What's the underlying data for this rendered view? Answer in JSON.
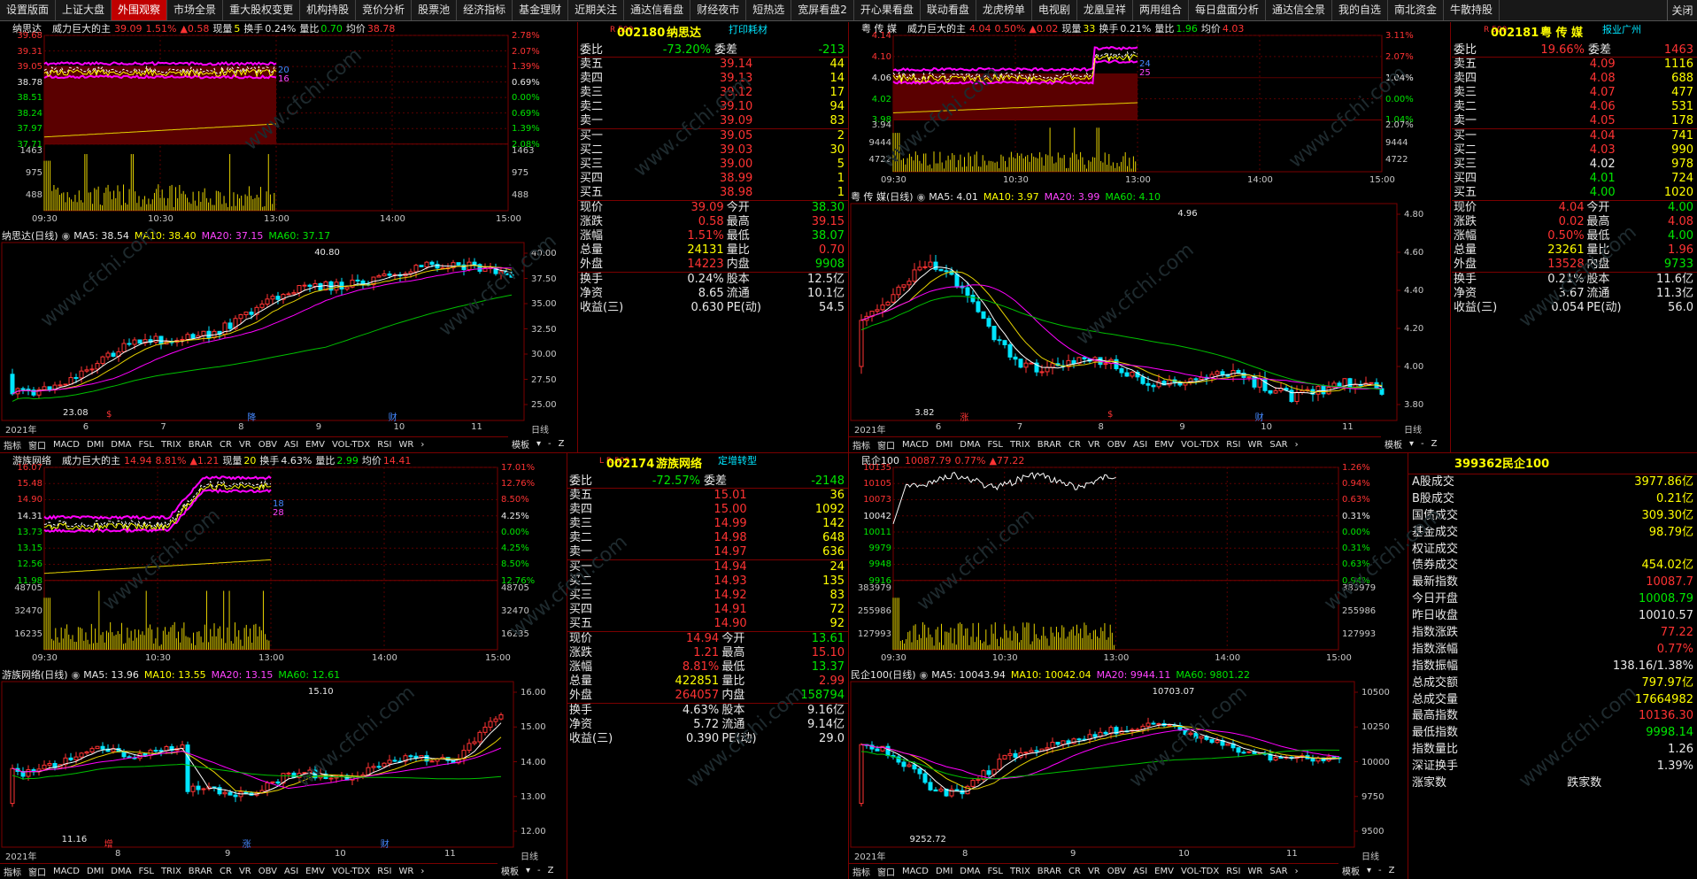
{
  "tabs": [
    "设置版面",
    "上证大盘",
    "外围观察",
    "市场全景",
    "重大股权变更",
    "机构持股",
    "竞价分析",
    "股票池",
    "经济指标",
    "基金理财",
    "近期关注",
    "通达信看盘",
    "财经夜市",
    "短热选",
    "宽屏看盘2",
    "开心果看盘",
    "联动看盘",
    "龙虎榜单",
    "电视剧",
    "龙凰呈祥",
    "两用组合",
    "每日盘面分析",
    "通达信全景",
    "我的自选",
    "南北资金",
    "牛散持股"
  ],
  "active_tab": 2,
  "close_label": "关闭",
  "watermark": "www.cfchi.com",
  "bottom_tabs": [
    "指标",
    "窗口",
    "MACD",
    "DMI",
    "DMA",
    "FSL",
    "TRIX",
    "BRAR",
    "CR",
    "VR",
    "OBV",
    "ASI",
    "EMV",
    "VOL-TDX",
    "RSI",
    "WR",
    "›"
  ],
  "bottom_tabs_b": [
    "指标",
    "窗口",
    "MACD",
    "DMI",
    "DMA",
    "FSL",
    "TRIX",
    "BRAR",
    "CR",
    "VR",
    "OBV",
    "ASI",
    "EMV",
    "VOL-TDX",
    "RSI",
    "WR",
    "SAR",
    "›"
  ],
  "bottom_right": [
    "模板",
    "▾",
    "-",
    "Z"
  ],
  "stocks": [
    {
      "id": "s1",
      "name": "纳思达",
      "indic": "威力巨大的主",
      "price": "39.09",
      "pct": "1.51%",
      "chg": "▲0.58",
      "vol_label": "现量",
      "vol": "5",
      "turn_label": "换手",
      "turn": "0.24%",
      "ratio_label": "量比",
      "ratio": "0.70",
      "avg_label": "均价",
      "avg": "38.78",
      "yl": [
        "39.68",
        "39.31",
        "39.05",
        "38.78",
        "38.51",
        "38.24",
        "37.97",
        "37.71",
        "1463",
        "975",
        "488"
      ],
      "yr": [
        "2.78%",
        "2.07%",
        "1.39%",
        "0.69%",
        "0.00%",
        "0.69%",
        "1.39%",
        "2.08%",
        "1463",
        "975",
        "488"
      ],
      "times": [
        "09:30",
        "10:30",
        "13:00",
        "14:00",
        "15:00"
      ],
      "marks": [
        "20",
        "16"
      ],
      "daily_title": "纳思达(日线)",
      "ma5": "MA5: 38.54",
      "ma10": "MA10: 38.40",
      "ma20": "MA20: 37.15",
      "ma60": "MA60: 37.17",
      "daily_y": [
        "40.00",
        "37.50",
        "35.00",
        "32.50",
        "30.00",
        "27.50",
        "25.00"
      ],
      "daily_hi": "40.80",
      "daily_lo": "23.08",
      "months": [
        "2021年",
        "6",
        "7",
        "8",
        "9",
        "10",
        "11"
      ],
      "events": [
        "$",
        "降",
        "财"
      ],
      "period": "日线",
      "code": "002180",
      "code_name": "纳思达",
      "code_tag": "打印耗材",
      "prefix": "R 500",
      "wb": "-73.20%",
      "wc": "-213",
      "sells": [
        [
          "卖五",
          "39.14",
          "44"
        ],
        [
          "卖四",
          "39.13",
          "14"
        ],
        [
          "卖三",
          "39.12",
          "17"
        ],
        [
          "卖二",
          "39.10",
          "94"
        ],
        [
          "卖一",
          "39.09",
          "83"
        ]
      ],
      "buys": [
        [
          "买一",
          "39.05",
          "2"
        ],
        [
          "买二",
          "39.03",
          "30"
        ],
        [
          "买三",
          "39.00",
          "5"
        ],
        [
          "买四",
          "38.99",
          "1"
        ],
        [
          "买五",
          "38.98",
          "1"
        ]
      ],
      "q": [
        [
          "现价",
          "39.09",
          "今开",
          "38.30"
        ],
        [
          "涨跌",
          "0.58",
          "最高",
          "39.15"
        ],
        [
          "涨幅",
          "1.51%",
          "最低",
          "38.07"
        ],
        [
          "总量",
          "24131",
          "量比",
          "0.70"
        ],
        [
          "外盘",
          "14223",
          "内盘",
          "9908"
        ]
      ],
      "f": [
        [
          "换手",
          "0.24%",
          "股本",
          "12.5亿"
        ],
        [
          "净资",
          "8.65",
          "流通",
          "10.1亿"
        ],
        [
          "收益(三)",
          "0.630",
          "PE(动)",
          "54.5"
        ]
      ]
    },
    {
      "id": "s2",
      "name": "粤 传 媒",
      "indic": "威力巨大的主",
      "price": "4.04",
      "pct": "0.50%",
      "chg": "▲0.02",
      "vol_label": "现量",
      "vol": "33",
      "turn_label": "换手",
      "turn": "0.21%",
      "ratio_label": "量比",
      "ratio": "1.96",
      "avg_label": "均价",
      "avg": "4.03",
      "yl": [
        "4.14",
        "4.10",
        "4.06",
        "4.02",
        "3.98",
        "3.94",
        "9444",
        "4722"
      ],
      "yr": [
        "3.11%",
        "2.07%",
        "1.04%",
        "0.00%",
        "1.04%",
        "2.07%",
        "9444",
        "4722"
      ],
      "times": [
        "09:30",
        "10:30",
        "13:00",
        "14:00",
        "15:00"
      ],
      "marks": [
        "24",
        "25"
      ],
      "daily_title": "粤 传 媒(日线)",
      "ma5": "MA5: 4.01",
      "ma10": "MA10: 3.97",
      "ma20": "MA20: 3.99",
      "ma60": "MA60: 4.10",
      "daily_y": [
        "4.80",
        "4.60",
        "4.40",
        "4.20",
        "4.00",
        "3.80"
      ],
      "daily_hi": "4.96",
      "daily_lo": "3.82",
      "months": [
        "2021年",
        "6",
        "7",
        "8",
        "9",
        "10",
        "11"
      ],
      "events": [
        "涨",
        "$",
        "财"
      ],
      "period": "日线",
      "code": "002181",
      "code_name": "粤 传 媒",
      "code_tag": "报业广州",
      "prefix": "R 500",
      "wb": "19.66%",
      "wc": "1463",
      "sells": [
        [
          "卖五",
          "4.09",
          "1116"
        ],
        [
          "卖四",
          "4.08",
          "688"
        ],
        [
          "卖三",
          "4.07",
          "477"
        ],
        [
          "卖二",
          "4.06",
          "531"
        ],
        [
          "卖一",
          "4.05",
          "178"
        ]
      ],
      "buys": [
        [
          "买一",
          "4.04",
          "741"
        ],
        [
          "买二",
          "4.03",
          "990"
        ],
        [
          "买三",
          "4.02",
          "978"
        ],
        [
          "买四",
          "4.01",
          "724"
        ],
        [
          "买五",
          "4.00",
          "1020"
        ]
      ],
      "q": [
        [
          "现价",
          "4.04",
          "今开",
          "4.00"
        ],
        [
          "涨跌",
          "0.02",
          "最高",
          "4.08"
        ],
        [
          "涨幅",
          "0.50%",
          "最低",
          "4.00"
        ],
        [
          "总量",
          "23261",
          "量比",
          "1.96"
        ],
        [
          "外盘",
          "13528",
          "内盘",
          "9733"
        ]
      ],
      "f": [
        [
          "换手",
          "0.21%",
          "股本",
          "11.6亿"
        ],
        [
          "净资",
          "3.67",
          "流通",
          "11.3亿"
        ],
        [
          "收益(三)",
          "0.054",
          "PE(动)",
          "56.0"
        ]
      ]
    },
    {
      "id": "s3",
      "name": "游族网络",
      "indic": "威力巨大的主",
      "price": "14.94",
      "pct": "8.81%",
      "chg": "▲1.21",
      "vol_label": "现量",
      "vol": "20",
      "turn_label": "换手",
      "turn": "4.63%",
      "ratio_label": "量比",
      "ratio": "2.99",
      "avg_label": "均价",
      "avg": "14.41",
      "yl": [
        "16.07",
        "15.48",
        "14.90",
        "14.31",
        "13.73",
        "13.15",
        "12.56",
        "11.98",
        "48705",
        "32470",
        "16235"
      ],
      "yr": [
        "17.01%",
        "12.76%",
        "8.50%",
        "4.25%",
        "0.00%",
        "4.25%",
        "8.50%",
        "12.76%",
        "48705",
        "32470",
        "16235"
      ],
      "times": [
        "09:30",
        "10:30",
        "13:00",
        "14:00",
        "15:00"
      ],
      "marks": [
        "18",
        "28"
      ],
      "daily_title": "游族网络(日线)",
      "ma5": "MA5: 13.96",
      "ma10": "MA10: 13.55",
      "ma20": "MA20: 13.15",
      "ma60": "MA60: 12.61",
      "daily_y": [
        "16.00",
        "15.00",
        "14.00",
        "13.00",
        "12.00"
      ],
      "daily_hi": "15.10",
      "daily_lo": "11.16",
      "months": [
        "2021年",
        "8",
        "9",
        "10",
        "11"
      ],
      "events": [
        "增",
        "涨",
        "财"
      ],
      "period": "日线",
      "code": "002174",
      "code_name": "游族网络",
      "code_tag": "定增转型",
      "prefix": "L R 500",
      "wb": "-72.57%",
      "wc": "-2148",
      "sells": [
        [
          "卖五",
          "15.01",
          "36"
        ],
        [
          "卖四",
          "15.00",
          "1092"
        ],
        [
          "卖三",
          "14.99",
          "142"
        ],
        [
          "卖二",
          "14.98",
          "648"
        ],
        [
          "卖一",
          "14.97",
          "636"
        ]
      ],
      "buys": [
        [
          "买一",
          "14.94",
          "24"
        ],
        [
          "买二",
          "14.93",
          "135"
        ],
        [
          "买三",
          "14.92",
          "83"
        ],
        [
          "买四",
          "14.91",
          "72"
        ],
        [
          "买五",
          "14.90",
          "92"
        ]
      ],
      "q": [
        [
          "现价",
          "14.94",
          "今开",
          "13.61"
        ],
        [
          "涨跌",
          "1.21",
          "最高",
          "15.10"
        ],
        [
          "涨幅",
          "8.81%",
          "最低",
          "13.37"
        ],
        [
          "总量",
          "422851",
          "量比",
          "2.99"
        ],
        [
          "外盘",
          "264057",
          "内盘",
          "158794"
        ]
      ],
      "f": [
        [
          "换手",
          "4.63%",
          "股本",
          "9.16亿"
        ],
        [
          "净资",
          "5.72",
          "流通",
          "9.14亿"
        ],
        [
          "收益(三)",
          "0.390",
          "PE(动)",
          "29.0"
        ]
      ]
    }
  ],
  "index": {
    "name": "民企100",
    "price": "10087.79",
    "pct": "0.77%",
    "chg": "▲77.22",
    "yl": [
      "10135",
      "10105",
      "10073",
      "10042",
      "10011",
      "9979",
      "9948",
      "9916",
      "383979",
      "255986",
      "127993"
    ],
    "yr": [
      "1.26%",
      "0.94%",
      "0.63%",
      "0.31%",
      "0.00%",
      "0.31%",
      "0.63%",
      "0.94%",
      "383979",
      "255986",
      "127993"
    ],
    "times": [
      "09:30",
      "10:30",
      "13:00",
      "14:00",
      "15:00"
    ],
    "daily_title": "民企100(日线)",
    "ma5": "MA5: 10043.94",
    "ma10": "MA10: 10042.04",
    "ma20": "MA20: 9944.11",
    "ma60": "MA60: 9801.22",
    "daily_y": [
      "10500",
      "10250",
      "10000",
      "9750",
      "9500"
    ],
    "daily_hi": "10703.07",
    "daily_lo": "9252.72",
    "months": [
      "2021年",
      "8",
      "9",
      "10",
      "11"
    ],
    "period": "日线",
    "code": "399362",
    "code_name": "民企100",
    "rows": [
      [
        "A股成交",
        "3977.86亿"
      ],
      [
        "B股成交",
        "0.21亿"
      ],
      [
        "国债成交",
        "309.30亿"
      ],
      [
        "基金成交",
        "98.79亿"
      ],
      [
        "权证成交",
        ""
      ],
      [
        "债券成交",
        "454.02亿"
      ],
      [
        "最新指数",
        "10087.7"
      ],
      [
        "今日开盘",
        "10008.79"
      ],
      [
        "昨日收盘",
        "10010.57"
      ],
      [
        "指数涨跌",
        "77.22"
      ],
      [
        "指数涨幅",
        "0.77%"
      ],
      [
        "指数振幅",
        "138.16/1.38%"
      ],
      [
        "总成交额",
        "797.97亿"
      ],
      [
        "总成交量",
        "17664982"
      ],
      [
        "最高指数",
        "10136.30"
      ],
      [
        "最低指数",
        "9998.14"
      ],
      [
        "指数量比",
        "1.26"
      ],
      [
        "深证换手",
        "1.39%"
      ]
    ],
    "updown": [
      "涨家数",
      "跌家数"
    ]
  }
}
